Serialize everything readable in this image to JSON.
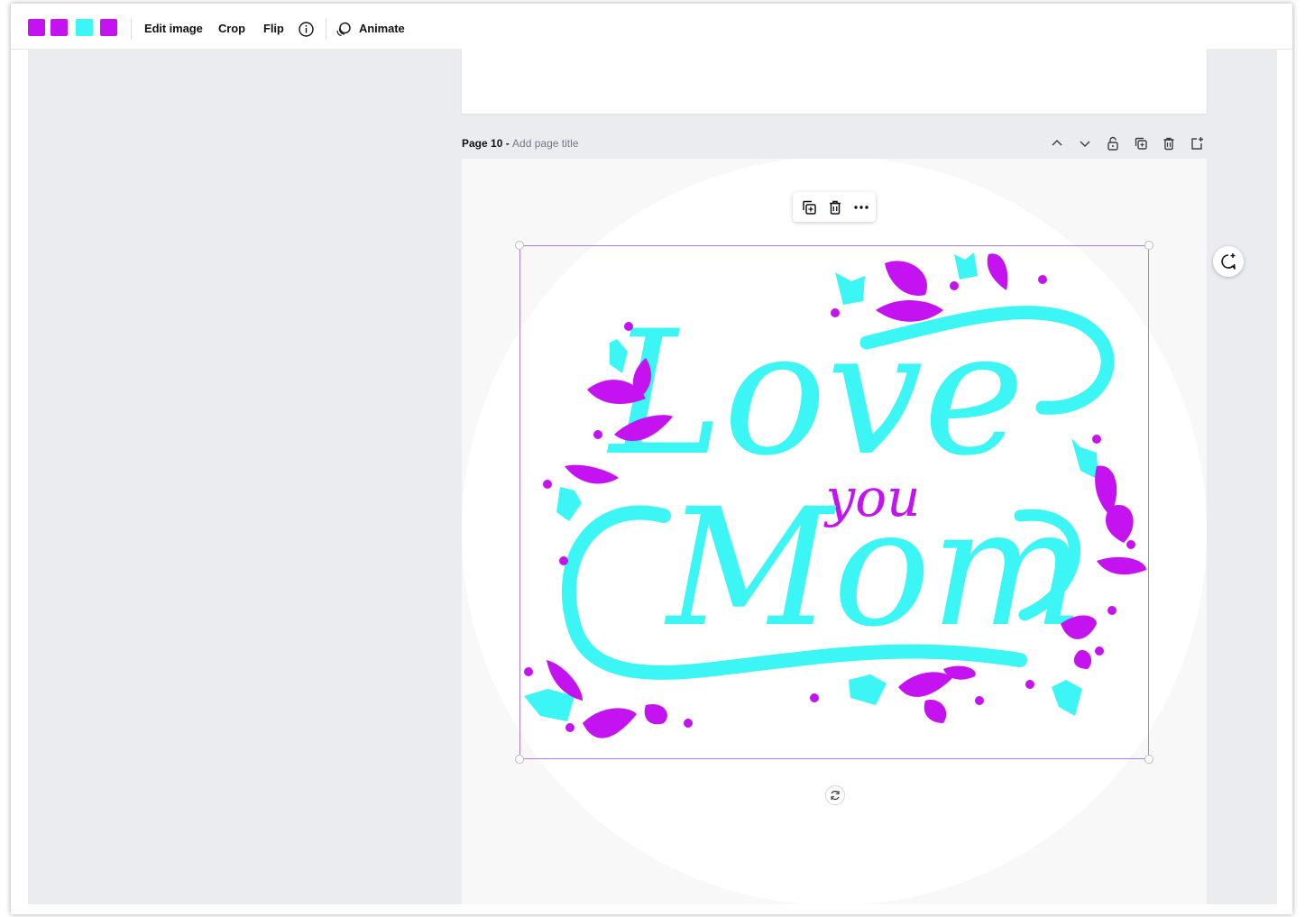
{
  "toolbar": {
    "color_swatches": [
      "#c412f0",
      "#c412f0",
      "#3cf5f5",
      "#c412f0"
    ],
    "edit_image_label": "Edit image",
    "crop_label": "Crop",
    "flip_label": "Flip",
    "animate_label": "Animate",
    "icons": [
      "info-icon",
      "animate-icon"
    ]
  },
  "page": {
    "number_label": "Page 10 - ",
    "title_placeholder": "Add page title",
    "tool_icons": [
      "chevron-up-icon",
      "chevron-down-icon",
      "lock-icon",
      "duplicate-page-icon",
      "delete-page-icon",
      "add-page-icon"
    ]
  },
  "context_menu": {
    "icons": [
      "duplicate-icon",
      "delete-icon",
      "more-icon"
    ]
  },
  "artwork": {
    "text_line_1": "Love",
    "text_line_2": "you",
    "text_line_3": "Mom",
    "primary_color": "#3cf5f5",
    "accent_color": "#c412f0"
  },
  "side": {
    "comment_icon": "add-comment-icon",
    "rotate_icon": "rotate-icon"
  },
  "colors": {
    "canvas_bg": "#ebecf0",
    "page_bg": "#f8f8f9",
    "selection": "#a77bf3"
  }
}
